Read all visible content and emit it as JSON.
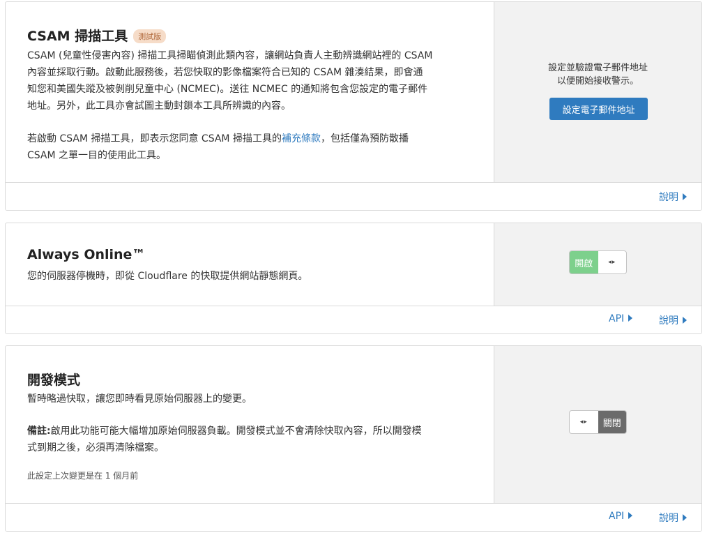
{
  "colors": {
    "accent": "#2f7bbf",
    "toggle_on": "#7dd08c",
    "toggle_off": "#6b6b6b",
    "beta_bg": "#f6dcc8"
  },
  "csam": {
    "title": "CSAM 掃描工具",
    "badge": "測試版",
    "desc_line1": "CSAM (兒童性侵害內容) 掃描工具掃瞄偵測此類內容，讓網站負責人主動辨識網站裡的 CSAM",
    "desc_line2": "內容並採取行動。啟動此服務後，若您快取的影像檔案符合已知的 CSAM 雜湊結果，即會通",
    "desc_line3": "知您和美國失蹤及被剝削兒童中心 (NCMEC)。送往 NCMEC 的通知將包含您設定的電子郵件",
    "desc_line4": "地址。另外，此工具亦會試圖主動封鎖本工具所辨識的內容。",
    "terms_before": "若啟動 CSAM 掃描工具，即表示您同意 CSAM 掃描工具的",
    "terms_link": "補充條款",
    "terms_after": "，包括僅為預防散播",
    "terms_line2": "CSAM 之單一目的使用此工具。",
    "right_line1": "設定並驗證電子郵件地址",
    "right_line2": "以便開始接收警示。",
    "button": "設定電子郵件地址",
    "help": "說明"
  },
  "always_online": {
    "title": "Always Online™",
    "desc": "您的伺服器停機時，即從 Cloudflare 的快取提供網站靜態網頁。",
    "toggle_state": "on",
    "toggle_label": "開啟",
    "toggle_knob": "◂▸",
    "api": "API",
    "help": "說明"
  },
  "dev_mode": {
    "title": "開發模式",
    "desc": "暫時略過快取，讓您即時看見原始伺服器上的變更。",
    "note_label": "備註:",
    "note_line1": "啟用此功能可能大幅增加原始伺服器負載。開發模式並不會清除快取內容，所以開發模",
    "note_line2": "式到期之後，必須再清除檔案。",
    "meta": "此設定上次變更是在 1 個月前",
    "toggle_state": "off",
    "toggle_label": "關閉",
    "toggle_knob": "◂▸",
    "api": "API",
    "help": "說明"
  }
}
